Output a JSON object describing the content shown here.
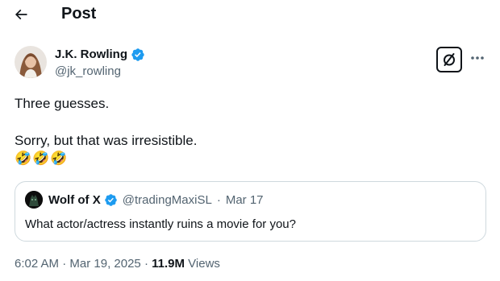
{
  "header": {
    "title": "Post",
    "back_icon": "arrow-left-icon"
  },
  "author": {
    "name": "J.K. Rowling",
    "handle": "@jk_rowling",
    "verified_icon": "verified-badge-icon",
    "verified_color": "#1d9bf0"
  },
  "actions": {
    "grok_icon": "grok-icon",
    "more_icon": "more-horizontal-icon"
  },
  "tweet": {
    "lines": [
      "Three guesses.",
      "Sorry, but that was irresistible.",
      "🤣🤣🤣"
    ]
  },
  "quote": {
    "name": "Wolf of X",
    "handle": "@tradingMaxiSL",
    "separator": "·",
    "date": "Mar 17",
    "text": "What actor/actress instantly ruins a movie for you?",
    "verified_icon": "verified-badge-icon"
  },
  "meta": {
    "time": "6:02 AM",
    "separator": "·",
    "date": "Mar 19, 2025",
    "views_count": "11.9M",
    "views_label": "Views"
  },
  "colors": {
    "text": "#0f1419",
    "secondary": "#536471",
    "border": "#cfd9de",
    "accent": "#1d9bf0"
  }
}
